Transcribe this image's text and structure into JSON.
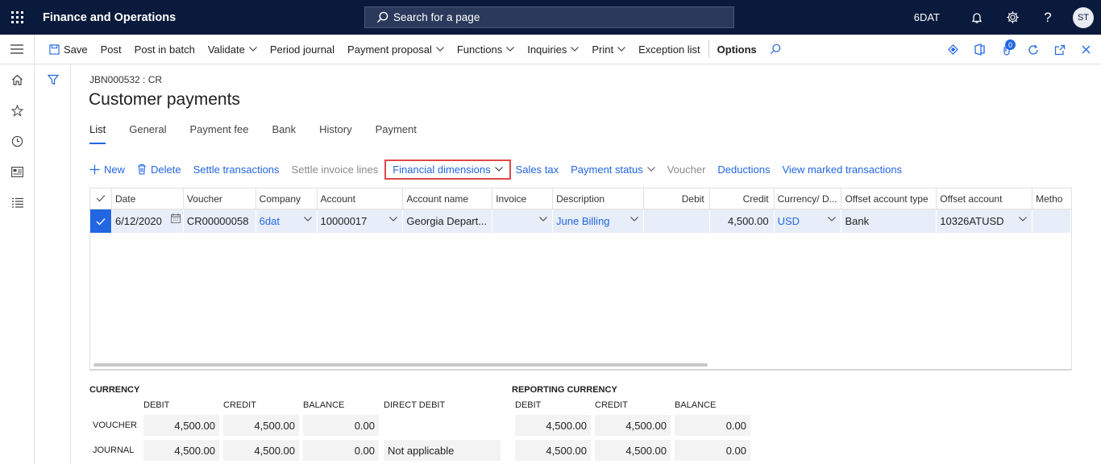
{
  "topbar": {
    "app_title": "Finance and Operations",
    "search_placeholder": "Search for a page",
    "company": "6DAT",
    "avatar_initials": "ST"
  },
  "actionbar": {
    "save": "Save",
    "post": "Post",
    "post_in_batch": "Post in batch",
    "validate": "Validate",
    "period_journal": "Period journal",
    "payment_proposal": "Payment proposal",
    "functions": "Functions",
    "inquiries": "Inquiries",
    "print": "Print",
    "exception_list": "Exception list",
    "options": "Options",
    "attachments_count": "0"
  },
  "page": {
    "caption": "JBN000532 : CR",
    "title": "Customer payments",
    "tabs": [
      "List",
      "General",
      "Payment fee",
      "Bank",
      "History",
      "Payment"
    ]
  },
  "gridbar": {
    "new": "New",
    "delete": "Delete",
    "settle_transactions": "Settle transactions",
    "settle_invoice_lines": "Settle invoice lines",
    "financial_dimensions": "Financial dimensions",
    "sales_tax": "Sales tax",
    "payment_status": "Payment status",
    "voucher": "Voucher",
    "deductions": "Deductions",
    "view_marked": "View marked transactions"
  },
  "grid": {
    "columns": [
      "Date",
      "Voucher",
      "Company",
      "Account",
      "Account name",
      "Invoice",
      "Description",
      "Debit",
      "Credit",
      "Currency/ D...",
      "Offset account type",
      "Offset account",
      "Metho"
    ],
    "row": {
      "date": "6/12/2020",
      "voucher": "CR00000058",
      "company": "6dat",
      "account": "10000017",
      "account_name": "Georgia Depart...",
      "invoice": "",
      "description": "June Billing",
      "debit": "",
      "credit": "4,500.00",
      "currency": "USD",
      "offset_type": "Bank",
      "offset_account": "10326ATUSD",
      "method": ""
    }
  },
  "totals": {
    "currency_title": "CURRENCY",
    "reporting_title": "REPORTING CURRENCY",
    "debit": "DEBIT",
    "credit": "CREDIT",
    "balance": "BALANCE",
    "direct_debit": "DIRECT DEBIT",
    "voucher_label": "VOUCHER",
    "journal_label": "JOURNAL",
    "voucher": {
      "debit": "4,500.00",
      "credit": "4,500.00",
      "balance": "0.00"
    },
    "journal": {
      "debit": "4,500.00",
      "credit": "4,500.00",
      "balance": "0.00",
      "direct_debit": "Not applicable"
    },
    "rep_voucher": {
      "debit": "4,500.00",
      "credit": "4,500.00",
      "balance": "0.00"
    },
    "rep_journal": {
      "debit": "4,500.00",
      "credit": "4,500.00",
      "balance": "0.00"
    }
  },
  "colors": {
    "topbar": "#0a1a3c",
    "accent": "#2266e3",
    "highlight_border": "#e04848",
    "row_selected": "#e8eef9"
  },
  "icons": [
    "waffle-icon",
    "search-icon",
    "bell-icon",
    "gear-icon",
    "help-icon",
    "hamburger-icon",
    "save-icon",
    "chevron-down-icon",
    "home-icon",
    "star-icon",
    "clock-icon",
    "workspace-icon",
    "list-icon",
    "filter-icon",
    "plus-icon",
    "trash-icon",
    "calendar-icon",
    "check-icon"
  ]
}
